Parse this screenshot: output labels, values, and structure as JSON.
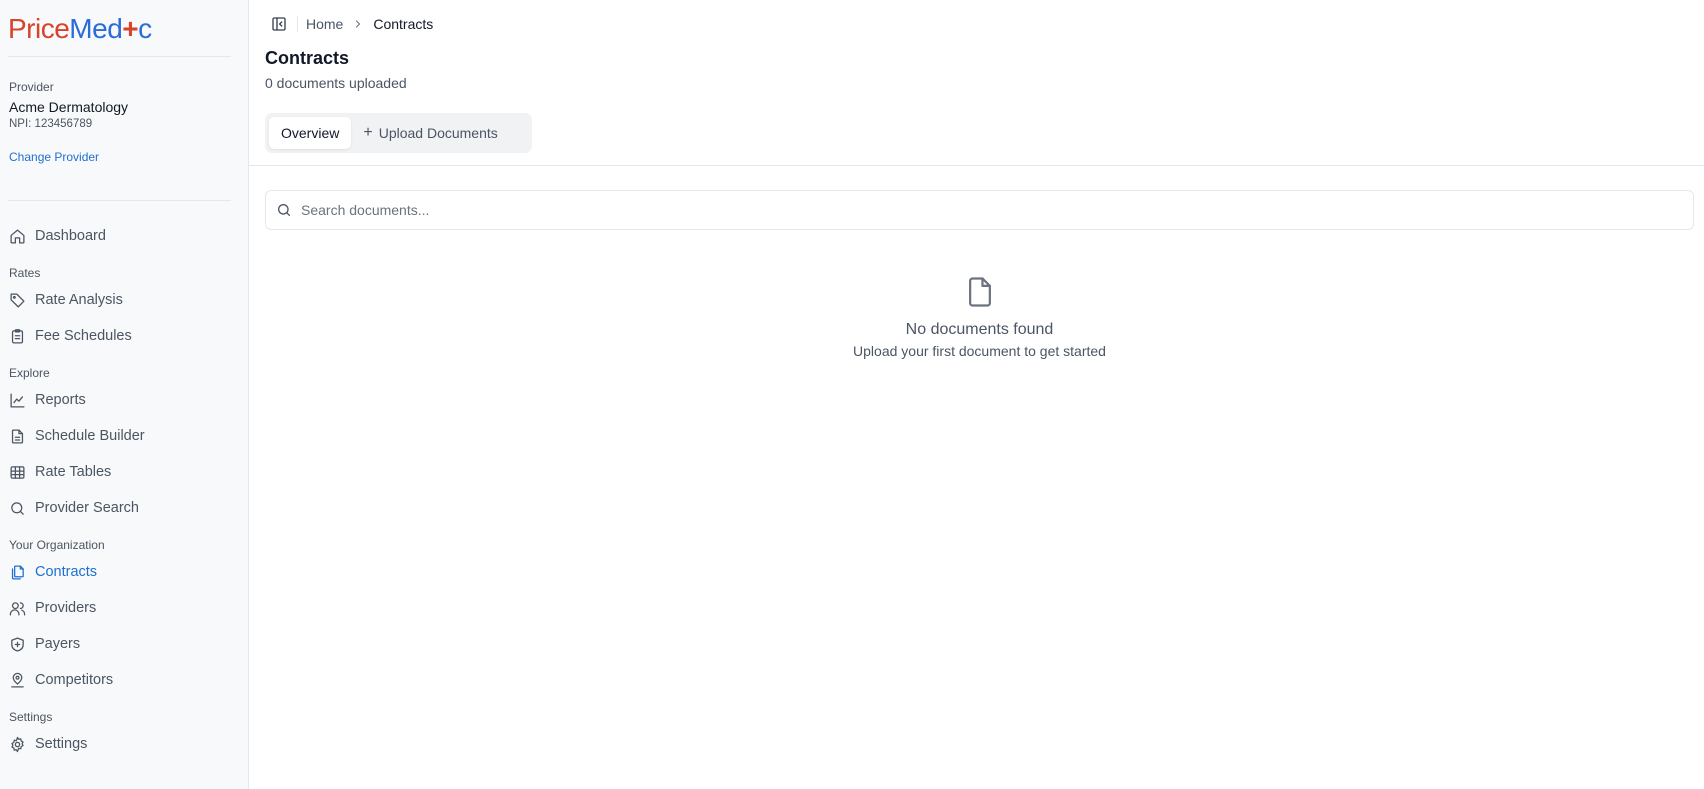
{
  "brand": {
    "price": "Price",
    "medic_pre": "Med",
    "medic_cross": "+",
    "medic_post": "c"
  },
  "provider": {
    "label": "Provider",
    "name": "Acme Dermatology",
    "npi": "NPI: 123456789",
    "change_label": "Change Provider"
  },
  "nav": {
    "dashboard": "Dashboard",
    "sections": {
      "rates": "Rates",
      "explore": "Explore",
      "org": "Your Organization",
      "settings": "Settings"
    },
    "rate_analysis": "Rate Analysis",
    "fee_schedules": "Fee Schedules",
    "reports": "Reports",
    "schedule_builder": "Schedule Builder",
    "rate_tables": "Rate Tables",
    "provider_search": "Provider Search",
    "contracts": "Contracts",
    "providers": "Providers",
    "payers": "Payers",
    "competitors": "Competitors",
    "settings": "Settings"
  },
  "breadcrumb": {
    "home": "Home",
    "current": "Contracts"
  },
  "page": {
    "title": "Contracts",
    "subtitle": "0 documents uploaded"
  },
  "tabs": {
    "overview": "Overview",
    "upload": "Upload Documents"
  },
  "search": {
    "placeholder": "Search documents...",
    "value": ""
  },
  "empty": {
    "title": "No documents found",
    "subtitle": "Upload your first document to get started"
  },
  "colors": {
    "accent": "#1f6fd1",
    "brand_red": "#d9422b",
    "brand_blue": "#2b6cd8"
  }
}
